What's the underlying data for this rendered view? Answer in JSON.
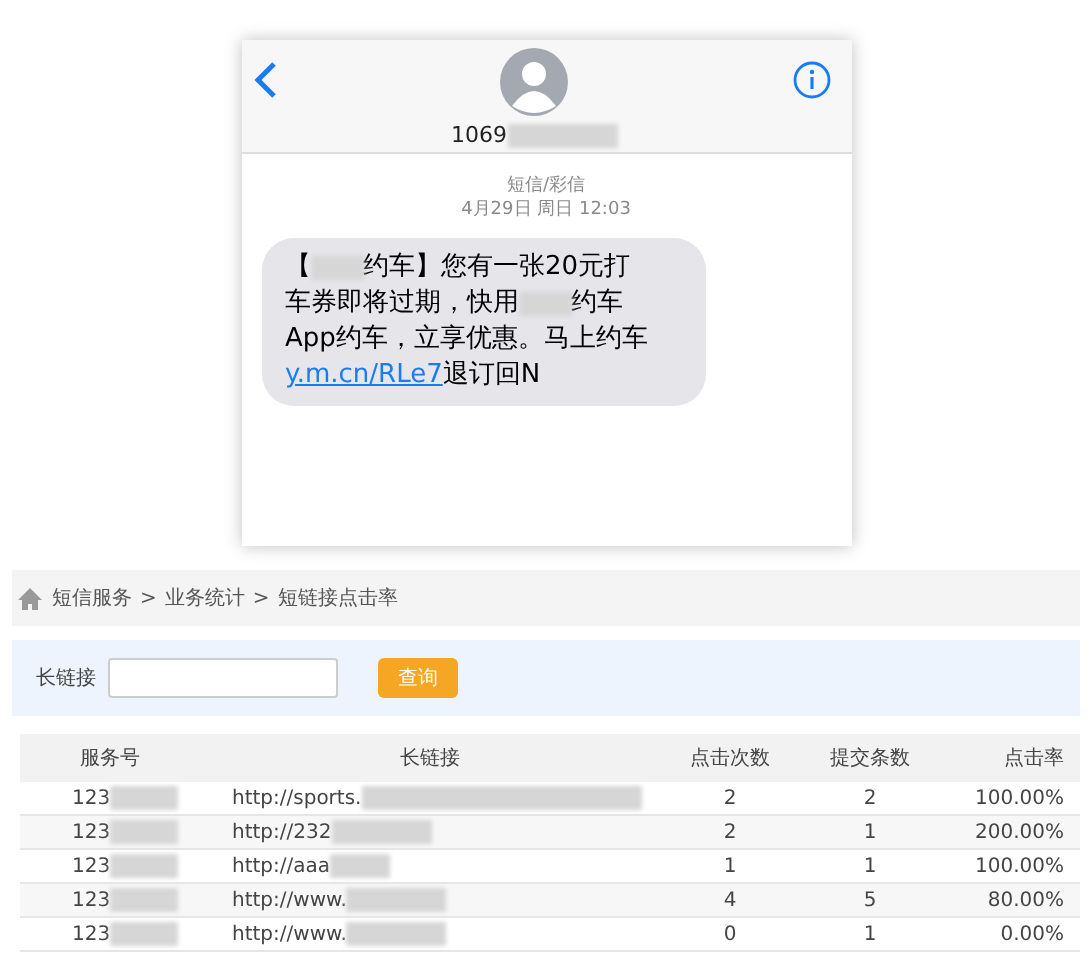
{
  "phone": {
    "sender": "1069",
    "meta": {
      "type": "短信/彩信",
      "time": "4月29日 周日 12:03"
    },
    "message": [
      [
        {
          "kind": "text",
          "text": "【"
        },
        {
          "kind": "redacted"
        },
        {
          "kind": "text",
          "text": "约车】您有一张20元打"
        }
      ],
      [
        {
          "kind": "text",
          "text": "车券即将过期，快用"
        },
        {
          "kind": "redacted"
        },
        {
          "kind": "text",
          "text": "约车"
        }
      ],
      [
        {
          "kind": "text",
          "text": "App约车，立享优惠。马上约车"
        }
      ],
      [
        {
          "kind": "link",
          "text": "y.m.cn/RLe7"
        },
        {
          "kind": "text",
          "text": "退订回N"
        }
      ]
    ]
  },
  "breadcrumb": [
    "短信服务",
    ">",
    "业务统计",
    ">",
    "短链接点击率"
  ],
  "filter": {
    "label": "长链接",
    "button": "查询"
  },
  "table": {
    "columns": [
      "服务号",
      "长链接",
      "点击次数",
      "提交条数",
      "点击率"
    ],
    "rows": [
      {
        "service": "123",
        "url": "http://sports.",
        "clicks": "2",
        "submitted": "2",
        "rate": "100.00%"
      },
      {
        "service": "123",
        "url": "http://232",
        "clicks": "2",
        "submitted": "1",
        "rate": "200.00%"
      },
      {
        "service": "123",
        "url": "http://aaa",
        "clicks": "1",
        "submitted": "1",
        "rate": "100.00%"
      },
      {
        "service": "123",
        "url": "http://www.",
        "clicks": "4",
        "submitted": "5",
        "rate": "80.00%"
      },
      {
        "service": "123",
        "url": "http://www.",
        "clicks": "0",
        "submitted": "1",
        "rate": "0.00%"
      }
    ]
  }
}
